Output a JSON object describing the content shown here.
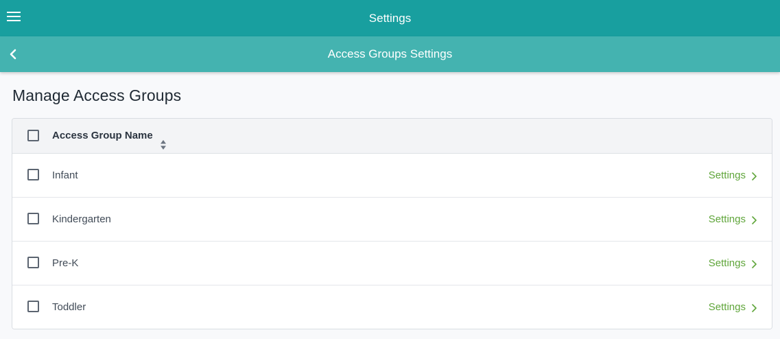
{
  "topbar": {
    "title": "Settings",
    "menu_icon": "hamburger-menu-icon"
  },
  "subbar": {
    "title": "Access Groups Settings",
    "back_icon": "chevron-left-icon"
  },
  "main": {
    "heading": "Manage Access Groups",
    "table": {
      "column_header": "Access Group Name",
      "sort_icon": "sort-updown-icon",
      "rows": [
        {
          "name": "Infant",
          "action": "Settings"
        },
        {
          "name": "Kindergarten",
          "action": "Settings"
        },
        {
          "name": "Pre-K",
          "action": "Settings"
        },
        {
          "name": "Toddler",
          "action": "Settings"
        }
      ]
    }
  },
  "colors": {
    "topbar": "#189f9f",
    "subbar": "#44b3b0",
    "link": "#5fa53a"
  }
}
